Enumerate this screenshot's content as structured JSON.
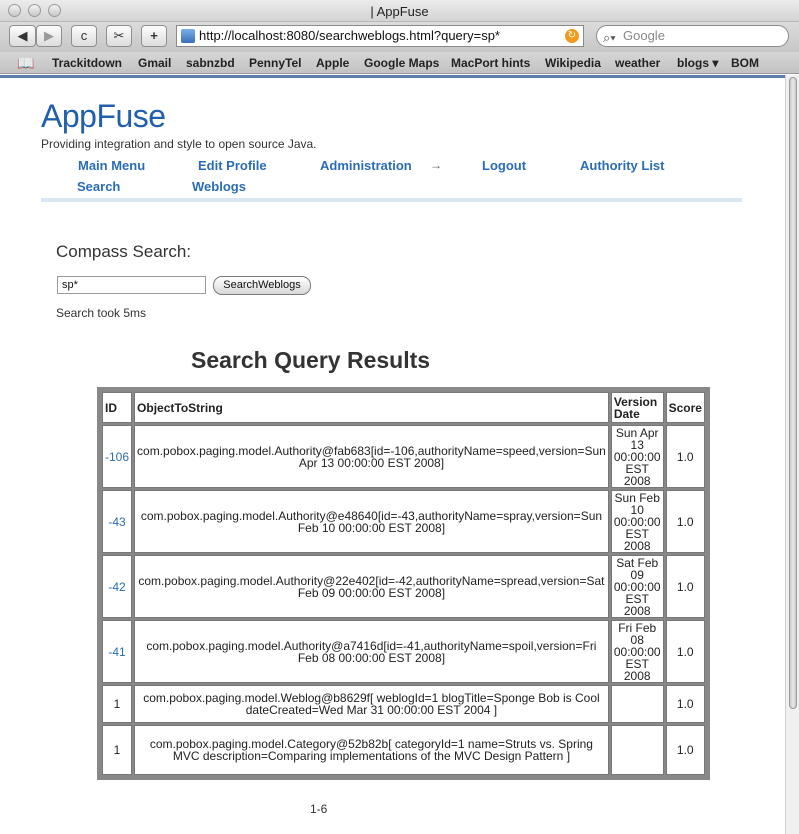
{
  "window": {
    "title": "| AppFuse"
  },
  "toolbar": {
    "back": "◀",
    "forward": "▶",
    "reload": "c",
    "snap": "✂",
    "add": "+",
    "url": "http://localhost:8080/searchweblogs.html?query=sp*",
    "search_placeholder": "Google"
  },
  "bookmarks": [
    "Trackitdown",
    "Gmail",
    "sabnzbd",
    "PennyTel",
    "Apple",
    "Google Maps",
    "MacPort hints",
    "Wikipedia",
    "weather",
    "blogs ▾",
    "BOM"
  ],
  "site": {
    "brand": "AppFuse",
    "tagline": "Providing integration and style to open source Java."
  },
  "nav": {
    "main_menu": "Main Menu",
    "edit_profile": "Edit Profile",
    "administration": "Administration",
    "arrow": "→",
    "logout": "Logout",
    "authority_list": "Authority List",
    "search": "Search",
    "weblogs": "Weblogs"
  },
  "search": {
    "heading": "Compass Search:",
    "query": "sp*",
    "button": "SearchWeblogs",
    "took": "Search took 5ms"
  },
  "results": {
    "heading": "Search Query Results",
    "columns": [
      "ID",
      "ObjectToString",
      "Version Date",
      "Score"
    ],
    "rows": [
      {
        "id": "-106",
        "object": "com.pobox.paging.model.Authority@fab683[id=-106,authorityName=speed,version=Sun Apr 13 00:00:00 EST 2008]",
        "version": "Sun Apr 13 00:00:00 EST 2008",
        "score": "1.0"
      },
      {
        "id": "-43",
        "object": "com.pobox.paging.model.Authority@e48640[id=-43,authorityName=spray,version=Sun Feb 10 00:00:00 EST 2008]",
        "version": "Sun Feb 10 00:00:00 EST 2008",
        "score": "1.0"
      },
      {
        "id": "-42",
        "object": "com.pobox.paging.model.Authority@22e402[id=-42,authorityName=spread,version=Sat Feb 09 00:00:00 EST 2008]",
        "version": "Sat Feb 09 00:00:00 EST 2008",
        "score": "1.0"
      },
      {
        "id": "-41",
        "object": "com.pobox.paging.model.Authority@a7416d[id=-41,authorityName=spoil,version=Fri Feb 08 00:00:00 EST 2008]",
        "version": "Fri Feb 08 00:00:00 EST 2008",
        "score": "1.0"
      },
      {
        "id": "1",
        "object": "com.pobox.paging.model.Weblog@b8629f[ weblogId=1 blogTitle=Sponge Bob is Cool dateCreated=Wed Mar 31 00:00:00 EST 2004 ]",
        "version": "",
        "score": "1.0"
      },
      {
        "id": "1",
        "object": "com.pobox.paging.model.Category@52b82b[ categoryId=1 name=Struts vs. Spring MVC description=Comparing implementations of the MVC Design Pattern ]",
        "version": "",
        "score": "1.0"
      }
    ],
    "pager": "1-6"
  }
}
